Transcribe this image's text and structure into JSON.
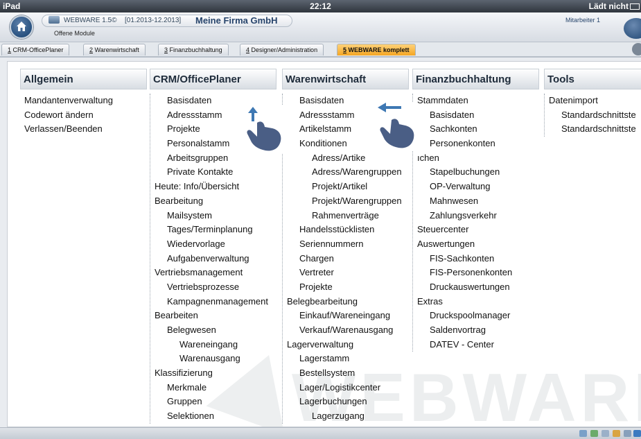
{
  "statusbar": {
    "device": "iPad",
    "time": "22:12",
    "charging": "Lädt nicht"
  },
  "header": {
    "app_version": "WEBWARE 1.5©",
    "period": "[01.2013-12.2013]",
    "company": "Meine Firma GmbH",
    "module": "Offene Module",
    "user": "Mitarbeiter 1"
  },
  "tabs": [
    {
      "num": "1",
      "label": "CRM-OfficePlaner"
    },
    {
      "num": "2",
      "label": "Warenwirtschaft"
    },
    {
      "num": "3",
      "label": "Finanzbuchhaltung"
    },
    {
      "num": "4",
      "label": "Designer/Administration"
    },
    {
      "num": "5",
      "label": "WEBWARE komplett"
    }
  ],
  "watermark": "WEBWARE",
  "columns": [
    {
      "title": "Allgemein",
      "items": [
        {
          "t": "Mandantenverwaltung",
          "lvl": 0
        },
        {
          "t": "Codewort ändern",
          "lvl": 0
        },
        {
          "t": "Verlassen/Beenden",
          "lvl": 0
        }
      ]
    },
    {
      "title": "CRM/OfficePlaner",
      "items": [
        {
          "t": "Basisdaten",
          "lvl": 1
        },
        {
          "t": "Adressstamm",
          "lvl": 1
        },
        {
          "t": "Projekte",
          "lvl": 1
        },
        {
          "t": "Personalstamm",
          "lvl": 1
        },
        {
          "t": "Arbeitsgruppen",
          "lvl": 1
        },
        {
          "t": "Private Kontakte",
          "lvl": 1
        },
        {
          "t": "Heute: Info/Übersicht",
          "lvl": 0
        },
        {
          "t": "Bearbeitung",
          "lvl": 0
        },
        {
          "t": "Mailsystem",
          "lvl": 1
        },
        {
          "t": "Tages/Terminplanung",
          "lvl": 1
        },
        {
          "t": "Wiedervorlage",
          "lvl": 1
        },
        {
          "t": "Aufgabenverwaltung",
          "lvl": 1
        },
        {
          "t": "Vertriebsmanagement",
          "lvl": 0
        },
        {
          "t": "Vertriebsprozesse",
          "lvl": 1
        },
        {
          "t": "Kampagnenmanagement",
          "lvl": 1
        },
        {
          "t": "Bearbeiten",
          "lvl": 0
        },
        {
          "t": "Belegwesen",
          "lvl": 1
        },
        {
          "t": "Wareneingang",
          "lvl": 2
        },
        {
          "t": "Warenausgang",
          "lvl": 2
        },
        {
          "t": "Klassifizierung",
          "lvl": 0
        },
        {
          "t": "Merkmale",
          "lvl": 1
        },
        {
          "t": "Gruppen",
          "lvl": 1
        },
        {
          "t": "Selektionen",
          "lvl": 1
        }
      ]
    },
    {
      "title": "Warenwirtschaft",
      "items": [
        {
          "t": "Basisdaten",
          "lvl": 1
        },
        {
          "t": "Adressstamm",
          "lvl": 1
        },
        {
          "t": "Artikelstamm",
          "lvl": 1
        },
        {
          "t": "Konditionen",
          "lvl": 1
        },
        {
          "t": "Adress/Artike",
          "lvl": 2
        },
        {
          "t": "Adress/Warengruppen",
          "lvl": 2
        },
        {
          "t": "Projekt/Artikel",
          "lvl": 2
        },
        {
          "t": "Projekt/Warengruppen",
          "lvl": 2
        },
        {
          "t": "Rahmenverträge",
          "lvl": 2
        },
        {
          "t": "Handelsstücklisten",
          "lvl": 1
        },
        {
          "t": "Seriennummern",
          "lvl": 1
        },
        {
          "t": "Chargen",
          "lvl": 1
        },
        {
          "t": "Vertreter",
          "lvl": 1
        },
        {
          "t": "Projekte",
          "lvl": 1
        },
        {
          "t": "Belegbearbeitung",
          "lvl": 0
        },
        {
          "t": "Einkauf/Wareneingang",
          "lvl": 1
        },
        {
          "t": "Verkauf/Warenausgang",
          "lvl": 1
        },
        {
          "t": "Lagerverwaltung",
          "lvl": 0
        },
        {
          "t": "Lagerstamm",
          "lvl": 1
        },
        {
          "t": "Bestellsystem",
          "lvl": 1
        },
        {
          "t": "Lager/Logistikcenter",
          "lvl": 1
        },
        {
          "t": "Lagerbuchungen",
          "lvl": 1
        },
        {
          "t": "Lagerzugang",
          "lvl": 2
        }
      ]
    },
    {
      "title": "Finanzbuchhaltung",
      "items": [
        {
          "t": "Stammdaten",
          "lvl": 0
        },
        {
          "t": "Basisdaten",
          "lvl": 1
        },
        {
          "t": "Sachkonten",
          "lvl": 1
        },
        {
          "t": "Personenkonten",
          "lvl": 1
        },
        {
          "t": "ıchen",
          "lvl": 0
        },
        {
          "t": "Stapelbuchungen",
          "lvl": 1
        },
        {
          "t": "OP-Verwaltung",
          "lvl": 1
        },
        {
          "t": "Mahnwesen",
          "lvl": 1
        },
        {
          "t": "Zahlungsverkehr",
          "lvl": 1
        },
        {
          "t": "Steuercenter",
          "lvl": 0
        },
        {
          "t": "Auswertungen",
          "lvl": 0
        },
        {
          "t": "FIS-Sachkonten",
          "lvl": 1
        },
        {
          "t": "FIS-Personenkonten",
          "lvl": 1
        },
        {
          "t": "Druckauswertungen",
          "lvl": 1
        },
        {
          "t": "Extras",
          "lvl": 0
        },
        {
          "t": "Druckspoolmanager",
          "lvl": 1
        },
        {
          "t": "Saldenvortrag",
          "lvl": 1
        },
        {
          "t": "DATEV - Center",
          "lvl": 1
        }
      ]
    },
    {
      "title": "Tools",
      "items": [
        {
          "t": "Datenimport",
          "lvl": 0
        },
        {
          "t": "Standardschnittste",
          "lvl": 1
        },
        {
          "t": "Standardschnittste",
          "lvl": 1
        }
      ]
    }
  ]
}
